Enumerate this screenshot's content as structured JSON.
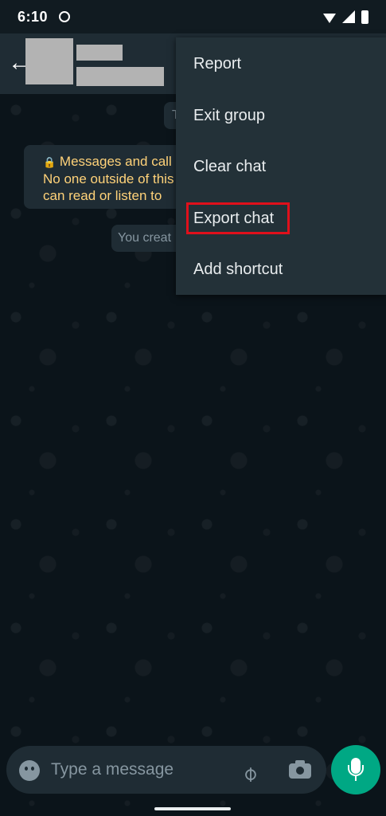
{
  "status_bar": {
    "time": "6:10"
  },
  "chat": {
    "date_fragment": "T",
    "encryption_lines": [
      "Messages and call",
      "No one outside of this",
      "can read or listen to"
    ],
    "created_fragment": "You creat"
  },
  "menu": {
    "items": [
      {
        "label": "Report"
      },
      {
        "label": "Exit group"
      },
      {
        "label": "Clear chat"
      },
      {
        "label": "Export chat"
      },
      {
        "label": "Add shortcut"
      }
    ],
    "highlight_color": "#e0101b"
  },
  "composer": {
    "placeholder": "Type a message"
  },
  "colors": {
    "background": "#0b141a",
    "appbar": "#1f2c34",
    "menu": "#233138",
    "accent": "#00a884",
    "system_text": "#ffd279"
  },
  "icons": [
    "back-arrow-icon",
    "lock-icon",
    "emoji-icon",
    "attach-icon",
    "camera-icon",
    "mic-icon"
  ]
}
